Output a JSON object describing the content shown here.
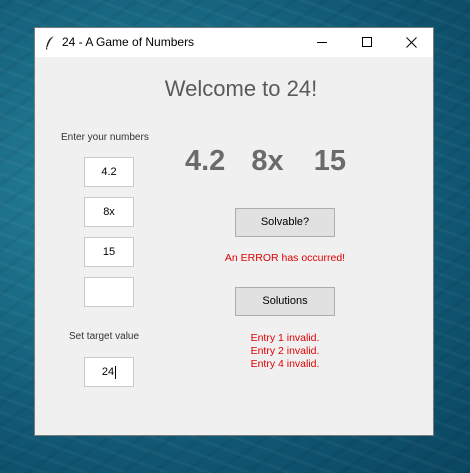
{
  "window": {
    "title": "24 - A Game of Numbers"
  },
  "heading": "Welcome to 24!",
  "inputs": {
    "label": "Enter your numbers",
    "values": [
      "4.2",
      "8x",
      "15",
      ""
    ]
  },
  "display_numbers": [
    "4.2",
    "8x",
    "15"
  ],
  "target": {
    "label": "Set target value",
    "value": "24"
  },
  "buttons": {
    "solvable": "Solvable?",
    "solutions": "Solutions"
  },
  "error_message": "An ERROR has occurred!",
  "invalid_entries": [
    "Entry 1 invalid.",
    "Entry 2 invalid.",
    "Entry 4 invalid."
  ],
  "colors": {
    "error": "#e00000",
    "numbers": "#6b6b6b",
    "heading": "#5a5a5a"
  },
  "icons": [
    "feather-icon",
    "minimize-icon",
    "maximize-icon",
    "close-icon"
  ]
}
